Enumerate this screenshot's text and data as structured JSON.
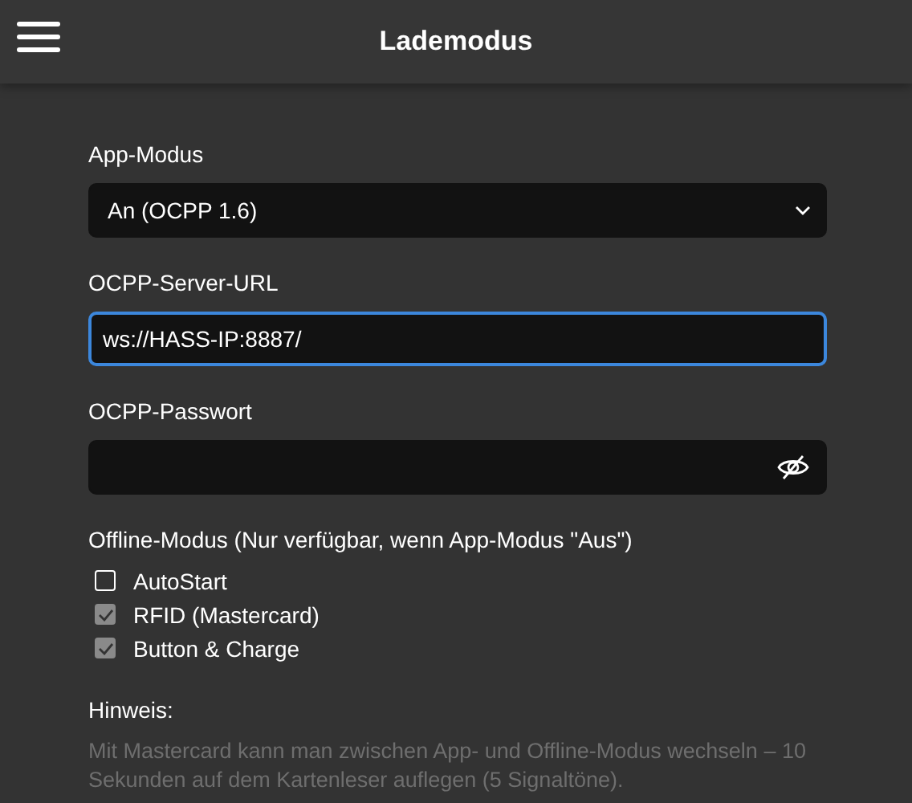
{
  "header": {
    "title": "Lademodus"
  },
  "app_mode": {
    "label": "App-Modus",
    "value": "An (OCPP 1.6)"
  },
  "server_url": {
    "label": "OCPP-Server-URL",
    "value": "ws://HASS-IP:8887/",
    "focused": true
  },
  "password": {
    "label": "OCPP-Passwort"
  },
  "offline": {
    "label": "Offline-Modus (Nur verfügbar, wenn App-Modus \"Aus\")",
    "options": [
      {
        "label": "AutoStart",
        "checked": false,
        "disabled": false
      },
      {
        "label": "RFID (Mastercard)",
        "checked": true,
        "disabled": true
      },
      {
        "label": "Button & Charge",
        "checked": true,
        "disabled": true
      }
    ]
  },
  "note": {
    "title": "Hinweis:",
    "text": "Mit Mastercard kann man zwischen App- und Offline-Modus wechseln – 10 Sekunden auf dem Kartenleser auflegen (5 Signaltöne)."
  }
}
